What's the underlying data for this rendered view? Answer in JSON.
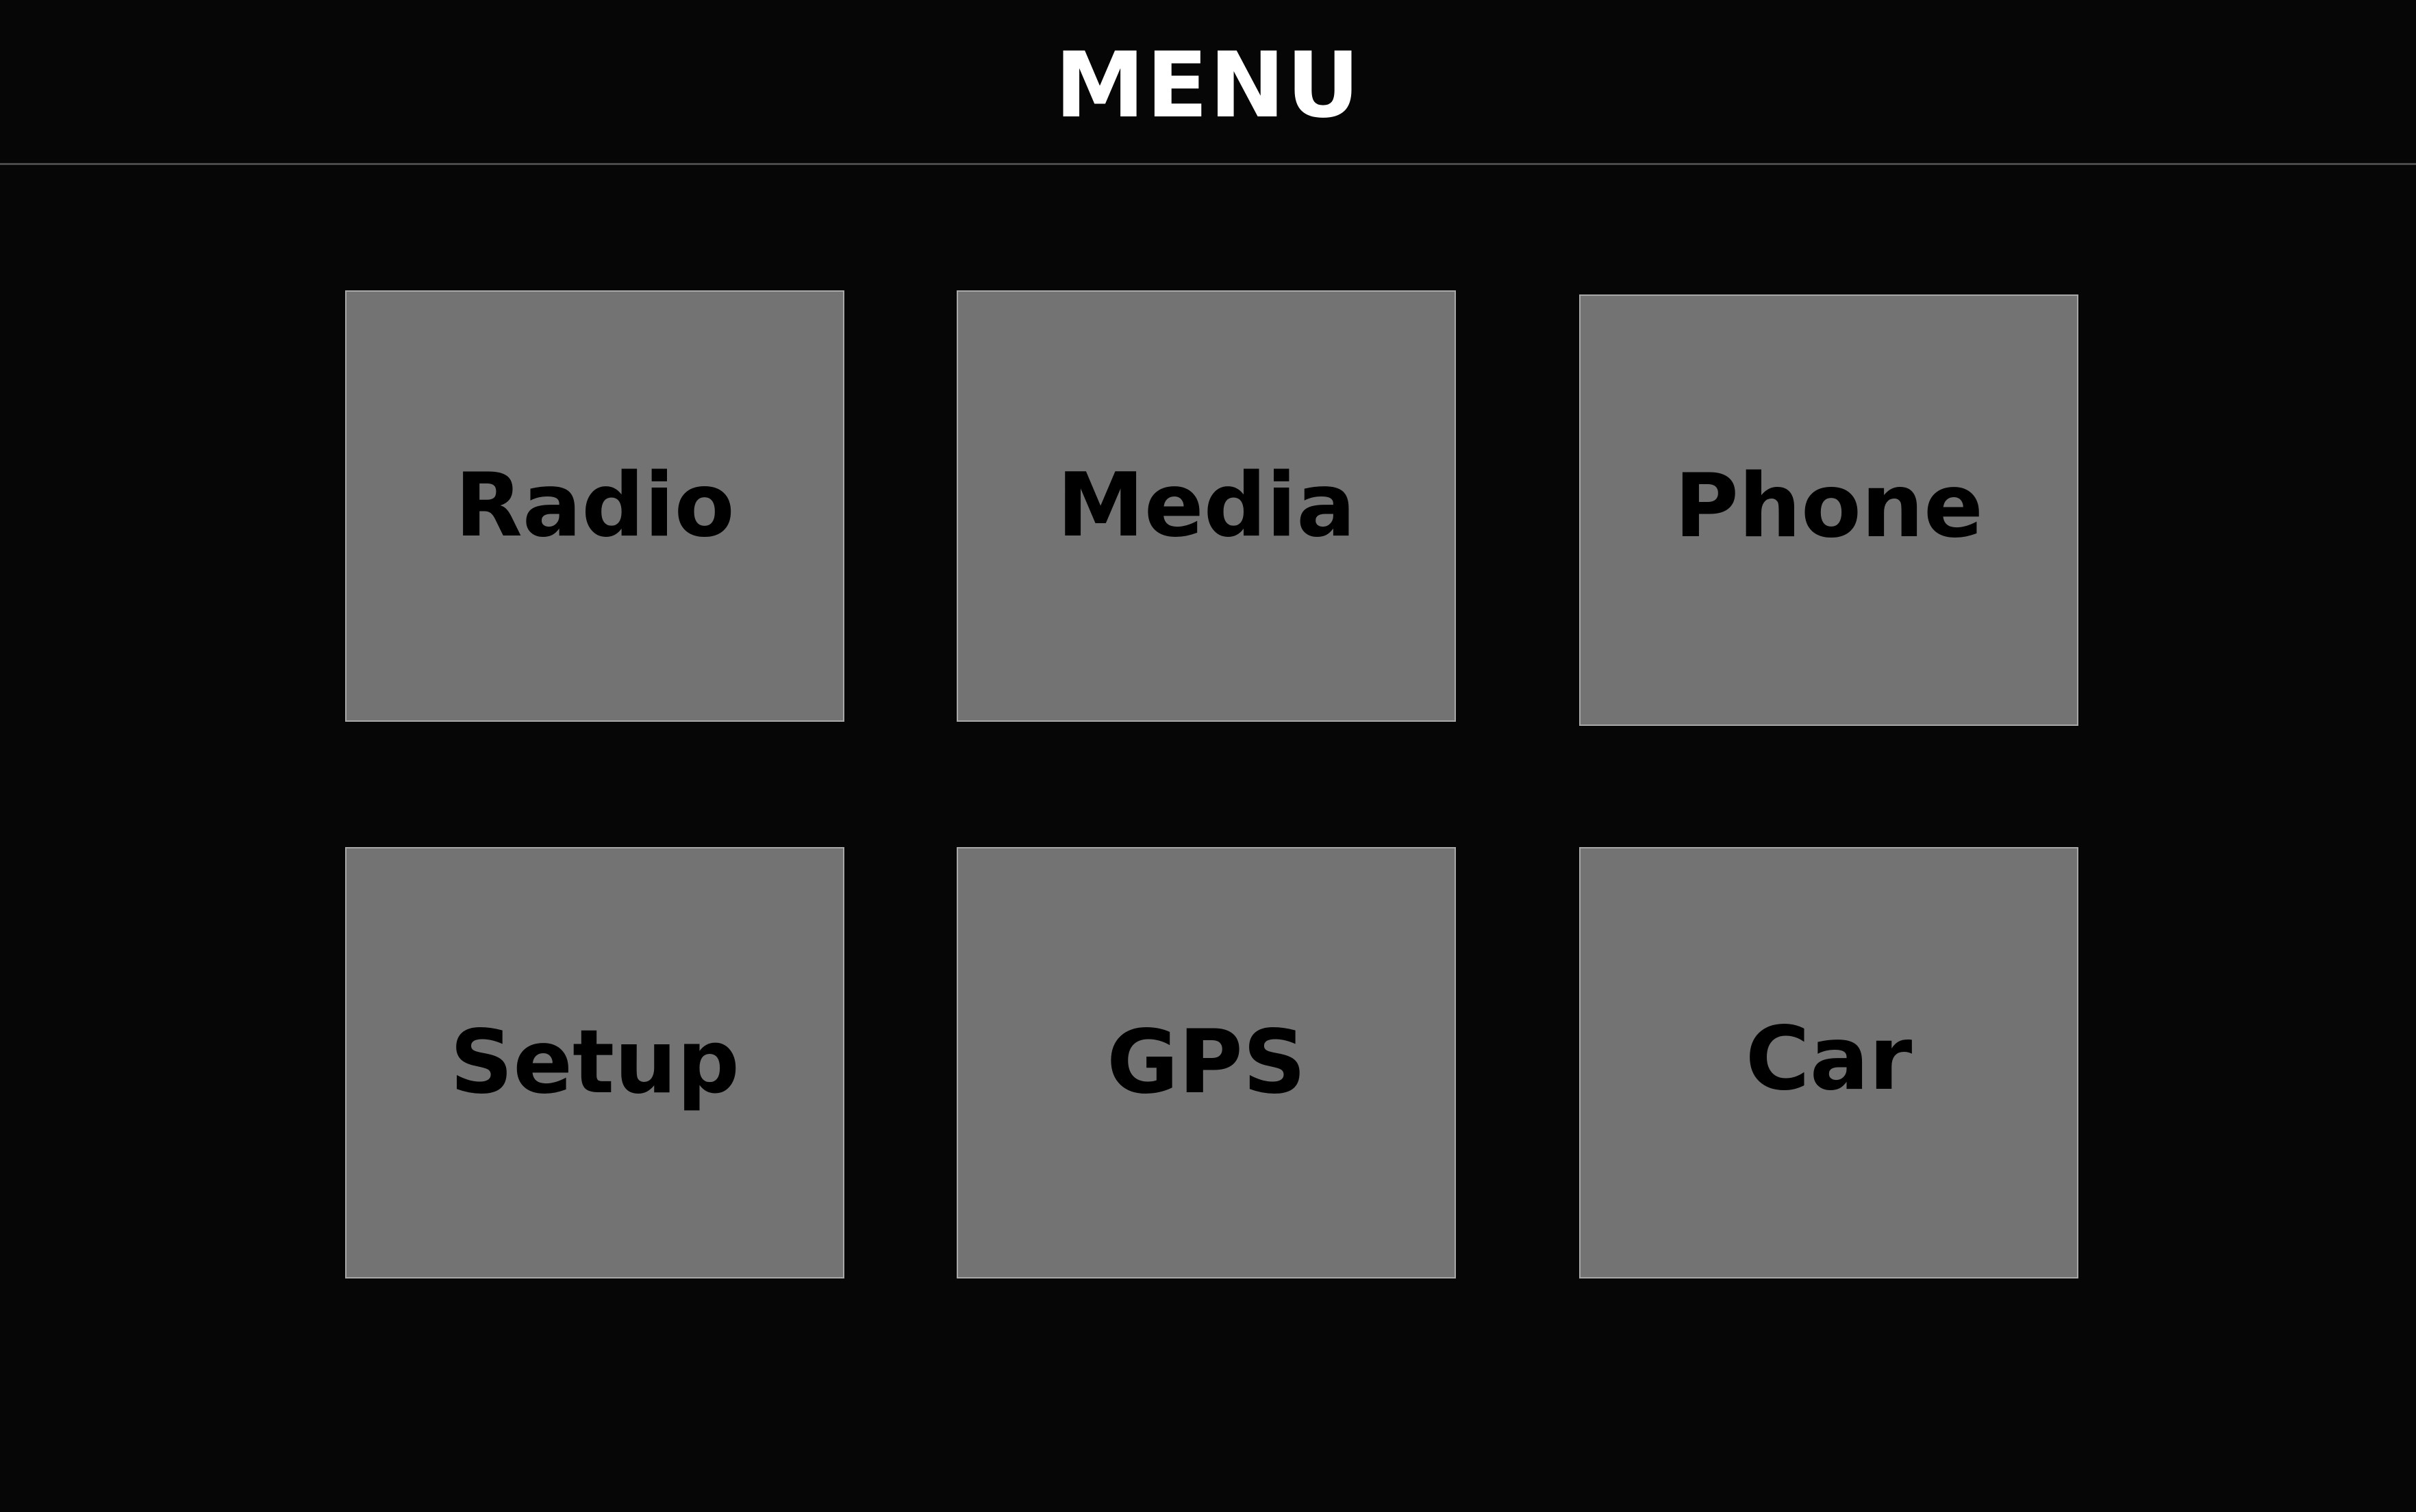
{
  "header": {
    "title": "MENU"
  },
  "menu": {
    "items": [
      {
        "label": "Radio"
      },
      {
        "label": "Media"
      },
      {
        "label": "Phone"
      },
      {
        "label": "Setup"
      },
      {
        "label": "GPS"
      },
      {
        "label": "Car"
      }
    ]
  },
  "colors": {
    "background": "#060606",
    "tile": "#737373",
    "tile_border": "#a8a8a8",
    "title": "#ffffff",
    "label": "#000000"
  }
}
